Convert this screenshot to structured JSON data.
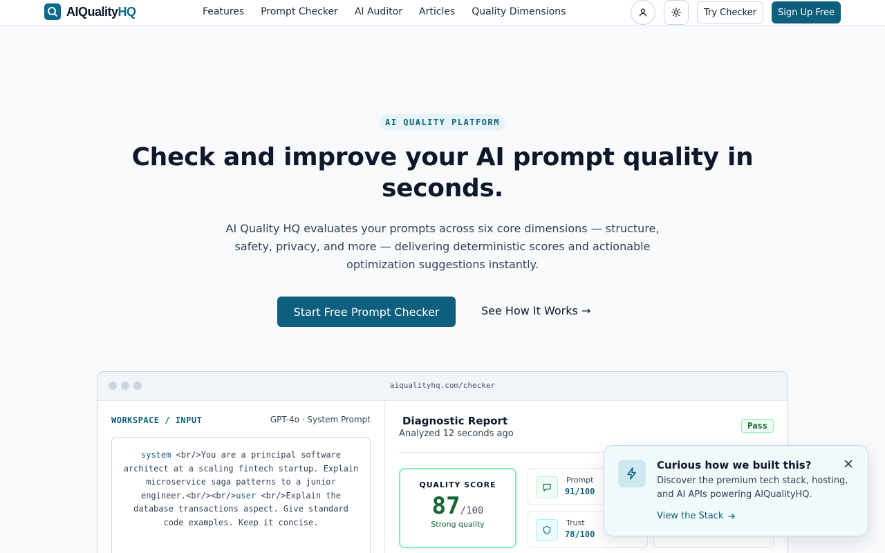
{
  "header": {
    "logo_main": "AIQuality",
    "logo_accent": "HQ",
    "nav": [
      "Features",
      "Prompt Checker",
      "AI Auditor",
      "Articles",
      "Quality Dimensions"
    ],
    "try_checker": "Try Checker",
    "sign_up": "Sign Up Free"
  },
  "hero": {
    "badge": "AI QUALITY PLATFORM",
    "title": "Check and improve your AI prompt quality in seconds.",
    "subtitle": "AI Quality HQ evaluates your prompts across six core dimensions — structure, safety, privacy, and more — delivering deterministic scores and actionable optimization suggestions instantly.",
    "cta_primary": "Start Free Prompt Checker",
    "cta_secondary": "See How It Works →"
  },
  "mockup": {
    "url": "aiqualityhq.com/checker",
    "workspace_label": "WORKSPACE / INPUT",
    "model": "GPT-4o · System Prompt",
    "prompt": {
      "kw_system": "system",
      "part1": " <br/>You are a principal software architect at a scaling fintech startup. Explain microservice saga patterns to a junior engineer.<br/><br/>",
      "kw_user": "user",
      "part2": " <br/>Explain the database transactions aspect. Give standard code examples. Keep it concise."
    },
    "report": {
      "title": "Diagnostic Report",
      "time": "Analyzed 12 seconds ago",
      "status": "Pass",
      "score_label": "QUALITY SCORE",
      "score": "87",
      "score_max": "/100",
      "score_note": "Strong quality",
      "metrics": [
        {
          "name": "Prompt",
          "score": "91/100",
          "icon": "chat-icon"
        },
        {
          "name": "Trust",
          "score": "78/100",
          "icon": "shield-icon"
        }
      ]
    }
  },
  "popup": {
    "title": "Curious how we built this?",
    "text": "Discover the premium tech stack, hosting, and AI APIs powering AIQualityHQ.",
    "link": "View the Stack"
  },
  "colors": {
    "primary": "#0e5f7d",
    "success": "#166534"
  }
}
